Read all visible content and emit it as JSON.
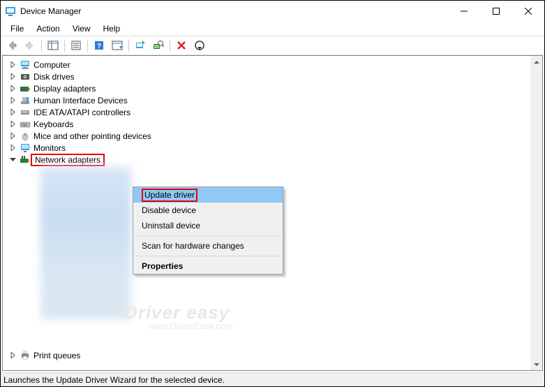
{
  "window": {
    "title": "Device Manager"
  },
  "menu": {
    "file": "File",
    "action": "Action",
    "view": "View",
    "help": "Help"
  },
  "tree": {
    "items": [
      {
        "label": "Computer",
        "expanded": false
      },
      {
        "label": "Disk drives",
        "expanded": false
      },
      {
        "label": "Display adapters",
        "expanded": false
      },
      {
        "label": "Human Interface Devices",
        "expanded": false
      },
      {
        "label": "IDE ATA/ATAPI controllers",
        "expanded": false
      },
      {
        "label": "Keyboards",
        "expanded": false
      },
      {
        "label": "Mice and other pointing devices",
        "expanded": false
      },
      {
        "label": "Monitors",
        "expanded": false
      },
      {
        "label": "Network adapters",
        "expanded": true,
        "highlighted": true
      },
      {
        "label": "Print queues",
        "expanded": false,
        "partially_visible": true
      }
    ]
  },
  "context_menu": {
    "update": "Update driver",
    "disable": "Disable device",
    "uninstall": "Uninstall device",
    "scan": "Scan for hardware changes",
    "properties": "Properties",
    "selected": "update"
  },
  "statusbar": {
    "text": "Launches the Update Driver Wizard for the selected device."
  },
  "watermark": {
    "line1": "Driver easy",
    "line2": "www.DriverEasy.com"
  }
}
